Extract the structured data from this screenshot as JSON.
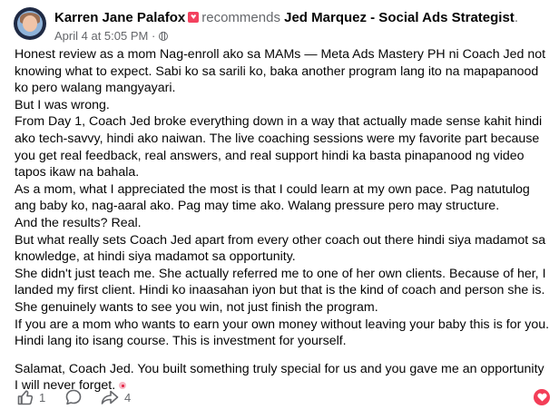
{
  "post": {
    "author": "Karren Jane Palafox",
    "verb": "recommends",
    "page_name": "Jed Marquez - Social Ads Strategist",
    "trailing_punct": ".",
    "timestamp": "April 4 at 5:05 PM",
    "separator": "·"
  },
  "body": {
    "paragraphs": [
      "Honest review as a mom Nag-enroll ako sa MAMs — Meta Ads Mastery PH ni Coach Jed not knowing what to expect. Sabi ko sa sarili ko, baka another program lang ito na mapapanood ko pero walang mangyayari.",
      "But I was wrong.",
      "From Day 1, Coach Jed broke everything down in a way that actually made sense kahit hindi ako tech-savvy, hindi ako naiwan. The live coaching sessions were my favorite part because you get real feedback, real answers, and real support hindi ka basta pinapanood ng video tapos ikaw na bahala.",
      "As a mom, what I appreciated the most is that I could learn at my own pace. Pag natutulog ang baby ko, nag-aaral ako. Pag may time ako. Walang pressure pero may structure.",
      "And the results? Real.",
      "But what really sets Coach Jed apart from every other coach out there hindi siya madamot sa knowledge, at hindi siya madamot sa opportunity.",
      "She didn't just teach me. She actually referred me to one of her own clients. Because of her, I landed my first client. Hindi ko inaasahan iyon but that is the kind of coach and person she is. She genuinely wants to see you win, not just finish the program.",
      "If you are a mom who wants to earn your own money without leaving your baby  this is for you. Hindi lang ito isang course. This is investment for yourself."
    ],
    "closing": "Salamat, Coach Jed. You built something truly special for us  and you gave me an opportunity I will never forget."
  },
  "actions": {
    "like_count": "1",
    "share_count": "4"
  },
  "icons": {
    "recommend": "recommend-heart-icon",
    "privacy": "globe-icon",
    "like": "thumbs-up-icon",
    "comment": "comment-icon",
    "share": "share-icon",
    "love": "love-reaction-icon",
    "emoji": "emoji-icon"
  },
  "colors": {
    "text": "#050505",
    "secondary": "#65676b",
    "recommend": "#f3425f",
    "love": "#f33e58"
  }
}
